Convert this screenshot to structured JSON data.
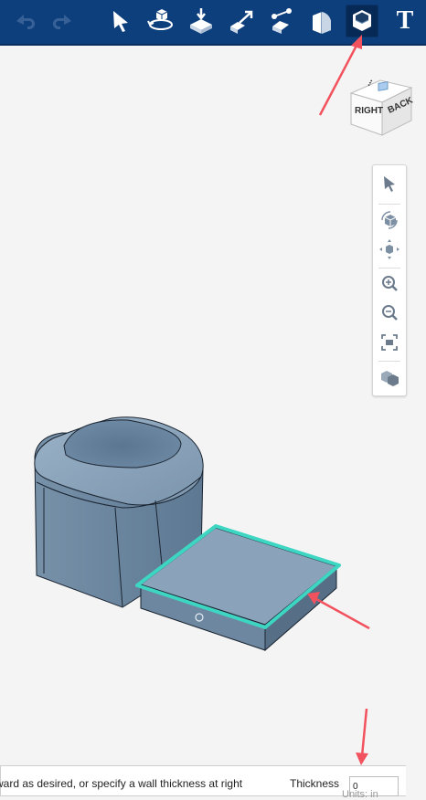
{
  "toolbar": {
    "buttons": [
      {
        "icon": "undo-icon",
        "enabled": false
      },
      {
        "icon": "redo-icon",
        "enabled": false
      },
      {
        "icon": "select-arrow-icon"
      },
      {
        "icon": "orbit-object-icon"
      },
      {
        "icon": "extrude-icon"
      },
      {
        "icon": "sweep-icon"
      },
      {
        "icon": "tweak-icon"
      },
      {
        "icon": "fillet-icon"
      },
      {
        "icon": "shell-icon",
        "active": true
      },
      {
        "icon": "text-tool-icon"
      }
    ],
    "text_tool_label": "T",
    "colors": {
      "background": "#0e3f7d",
      "active": "#062a55"
    }
  },
  "viewcube": {
    "faces": {
      "right": "RIGHT",
      "back": "BACK",
      "top_mark": "⸱⸱⸱"
    }
  },
  "navbar": {
    "items": [
      "select-icon",
      "orbit-icon",
      "pan-icon",
      "zoom-in-icon",
      "zoom-out-icon",
      "fit-to-view-icon",
      "view-style-icon"
    ]
  },
  "scene": {
    "selection_color": "#3dd6c2",
    "body_color": "#6d8aa3"
  },
  "hint": {
    "text": "ward as desired, or specify a wall thickness at right",
    "thickness_label": "Thickness",
    "thickness_value": "0",
    "units_label": "Units: in"
  },
  "annotations": {
    "arrow_color": "#f2525e"
  }
}
